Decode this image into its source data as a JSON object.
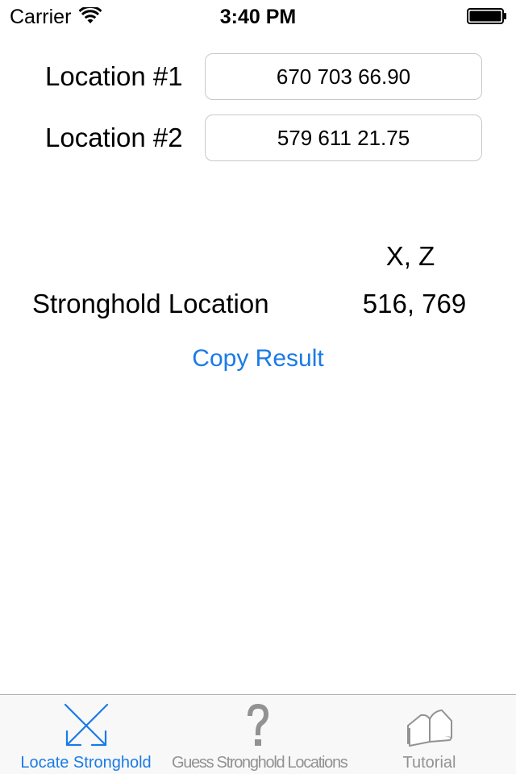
{
  "status_bar": {
    "carrier": "Carrier",
    "time": "3:40 PM",
    "icons": [
      "wifi-icon",
      "battery-icon"
    ]
  },
  "form": {
    "location1": {
      "label": "Location #1",
      "value": "670 703 66.90"
    },
    "location2": {
      "label": "Location #2",
      "value": "579 611 21.75"
    }
  },
  "result": {
    "column_header": "X, Z",
    "label": "Stronghold Location",
    "value": "516, 769",
    "copy_label": "Copy Result"
  },
  "tab_bar": {
    "tabs": [
      {
        "label": "Locate Stronghold",
        "icon": "crossed-arrows-icon",
        "active": true
      },
      {
        "label": "Guess Stronghold Locations",
        "icon": "question-mark-icon",
        "active": false
      },
      {
        "label": "Tutorial",
        "icon": "book-icon",
        "active": false
      }
    ]
  },
  "colors": {
    "accent": "#1a7be6",
    "inactive": "#929292",
    "tab_bar_bg": "#f8f8f8",
    "input_border": "#c8c8cc"
  }
}
